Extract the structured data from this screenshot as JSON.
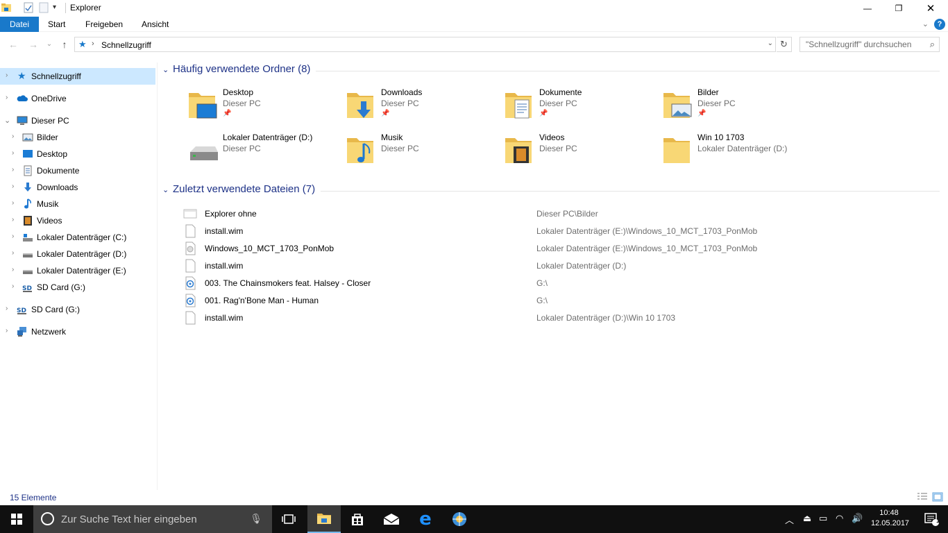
{
  "window": {
    "title": "Explorer",
    "minimize": "—",
    "restore": "❐",
    "close": "✕"
  },
  "ribbon": {
    "tabs": [
      "Datei",
      "Start",
      "Freigeben",
      "Ansicht"
    ],
    "help": "?",
    "expand": "⌄"
  },
  "nav": {
    "back": "←",
    "forward": "→",
    "recent": "⌄",
    "up": "↑",
    "path": "Schnellzugriff",
    "refresh": "↻",
    "search_placeholder": "\"Schnellzugriff\" durchsuchen"
  },
  "sidebar": {
    "items": [
      {
        "label": "Schnellzugriff",
        "icon": "star-icon",
        "selected": true
      },
      {
        "label": "OneDrive",
        "icon": "cloud-icon"
      },
      {
        "label": "Dieser PC",
        "icon": "computer-icon",
        "expanded": true
      },
      {
        "label": "Bilder",
        "icon": "pictures-icon"
      },
      {
        "label": "Desktop",
        "icon": "desktop-icon"
      },
      {
        "label": "Dokumente",
        "icon": "documents-icon"
      },
      {
        "label": "Downloads",
        "icon": "downloads-icon"
      },
      {
        "label": "Musik",
        "icon": "music-icon"
      },
      {
        "label": "Videos",
        "icon": "videos-icon"
      },
      {
        "label": "Lokaler Datenträger (C:)",
        "icon": "windows-drive-icon"
      },
      {
        "label": "Lokaler Datenträger (D:)",
        "icon": "drive-icon"
      },
      {
        "label": "Lokaler Datenträger (E:)",
        "icon": "drive-icon"
      },
      {
        "label": "SD Card (G:)",
        "icon": "sd-card-icon"
      },
      {
        "label": "SD Card (G:)",
        "icon": "sd-card-icon"
      },
      {
        "label": "Netzwerk",
        "icon": "network-icon"
      }
    ]
  },
  "frequent": {
    "title": "Häufig verwendete Ordner (8)",
    "folders": [
      {
        "name": "Desktop",
        "location": "Dieser PC",
        "pinned": true,
        "icon": "desktop-folder-icon"
      },
      {
        "name": "Downloads",
        "location": "Dieser PC",
        "pinned": true,
        "icon": "downloads-folder-icon"
      },
      {
        "name": "Dokumente",
        "location": "Dieser PC",
        "pinned": true,
        "icon": "documents-folder-icon"
      },
      {
        "name": "Bilder",
        "location": "Dieser PC",
        "pinned": true,
        "icon": "pictures-folder-icon"
      },
      {
        "name": "Lokaler Datenträger (D:)",
        "location": "Dieser PC",
        "pinned": false,
        "icon": "drive-icon"
      },
      {
        "name": "Musik",
        "location": "Dieser PC",
        "pinned": false,
        "icon": "music-folder-icon"
      },
      {
        "name": "Videos",
        "location": "Dieser PC",
        "pinned": false,
        "icon": "videos-folder-icon"
      },
      {
        "name": "Win 10 1703",
        "location": "Lokaler Datenträger (D:)",
        "pinned": false,
        "icon": "folder-icon"
      }
    ]
  },
  "recent": {
    "title": "Zuletzt verwendete Dateien (7)",
    "files": [
      {
        "name": "Explorer ohne",
        "location": "Dieser PC\\Bilder",
        "icon": "image-file-icon"
      },
      {
        "name": "install.wim",
        "location": "Lokaler Datenträger (E:)\\Windows_10_MCT_1703_PonMob",
        "icon": "file-icon"
      },
      {
        "name": "Windows_10_MCT_1703_PonMob",
        "location": "Lokaler Datenträger (E:)\\Windows_10_MCT_1703_PonMob",
        "icon": "disc-image-icon"
      },
      {
        "name": "install.wim",
        "location": "Lokaler Datenträger (D:)",
        "icon": "file-icon"
      },
      {
        "name": "003. The Chainsmokers feat. Halsey - Closer",
        "location": "G:\\",
        "icon": "audio-file-icon"
      },
      {
        "name": "001. Rag'n'Bone Man - Human",
        "location": "G:\\",
        "icon": "audio-file-icon"
      },
      {
        "name": "install.wim",
        "location": "Lokaler Datenträger (D:)\\Win 10 1703",
        "icon": "file-icon"
      }
    ]
  },
  "status": {
    "count": "15 Elemente"
  },
  "taskbar": {
    "search_placeholder": "Zur Suche Text hier eingeben",
    "time": "10:48",
    "date": "12.05.2017",
    "notifications": "1"
  },
  "colors": {
    "accent": "#1979ca",
    "selection": "#cce8ff",
    "heading": "#1e3287",
    "folder": "#f8d775",
    "taskbar": "#101010"
  }
}
